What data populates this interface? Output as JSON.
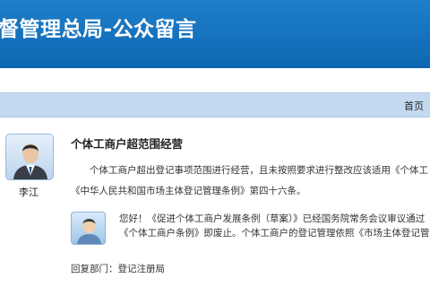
{
  "banner": {
    "title": "督管理总局-公众留言"
  },
  "breadcrumb": {
    "home": "首页"
  },
  "message": {
    "asker_name": "李江",
    "title": "个体工商户超范围经营",
    "body_line1": "个体工商户超出登记事项范围进行经营，且未按照要求进行整改应该适用《个体工",
    "body_line2": "《中华人民共和国市场主体登记管理条例》第四十六条。"
  },
  "reply": {
    "line1": "您好！《促进个体工商户发展条例（草案）》已经国务院常务会议审议通过",
    "line2": "《个体工商户条例》即废止。个体工商户的登记管理依照《市场主体登记管",
    "dept_label": "回复部门：",
    "dept_value": "登记注册局"
  },
  "colors": {
    "banner": "#1672bd",
    "breadcrumb_bar": "#c4daf1"
  },
  "icons": {
    "asker_avatar": "businessman-avatar-icon",
    "reply_avatar": "official-avatar-icon"
  }
}
